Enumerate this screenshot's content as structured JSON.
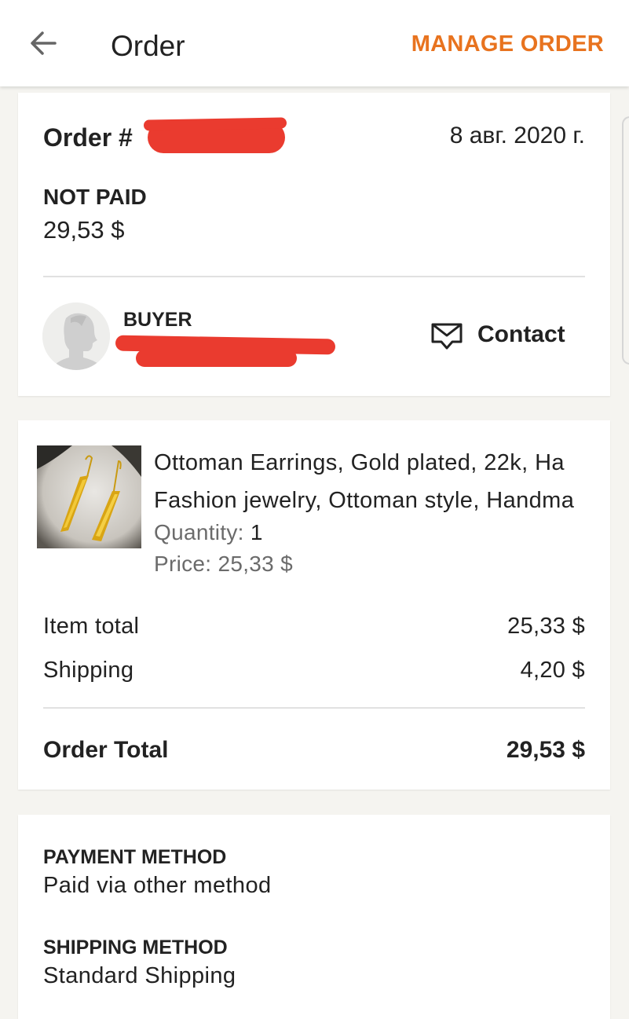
{
  "appbar": {
    "title": "Order",
    "manage_label": "MANAGE ORDER",
    "accent_color": "#e8731f"
  },
  "order": {
    "number_prefix": "Order #",
    "date": "8 авг. 2020 г.",
    "status": "NOT PAID",
    "amount": "29,53 $",
    "redaction_color": "#ea3b2f"
  },
  "buyer": {
    "label": "BUYER",
    "avatar_icon": "person-silhouette-icon",
    "contact_icon": "message-icon",
    "contact_label": "Contact"
  },
  "item": {
    "image_icon": "gold-earrings-photo",
    "title_line1": "Ottoman Earrings, Gold plated, 22k, Ha",
    "title_line2": "Fashion jewelry, Ottoman style, Handma",
    "quantity_label": "Quantity:",
    "quantity_value": "1",
    "price_label": "Price:",
    "price_value": "25,33 $"
  },
  "summary": {
    "rows": [
      {
        "label": "Item total",
        "value": "25,33 $"
      },
      {
        "label": "Shipping",
        "value": "4,20 $"
      }
    ],
    "total_label": "Order Total",
    "total_value": "29,53 $"
  },
  "payment": {
    "label": "PAYMENT METHOD",
    "value": "Paid via other method"
  },
  "shipping": {
    "label": "SHIPPING METHOD",
    "value": "Standard Shipping"
  }
}
